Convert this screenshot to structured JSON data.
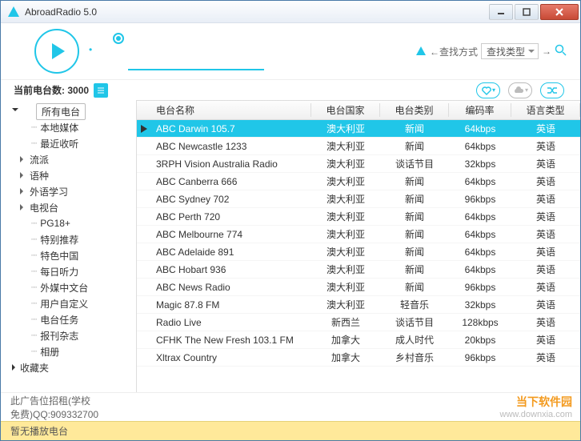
{
  "window": {
    "title": "AbroadRadio 5.0"
  },
  "count": {
    "label": "当前电台数:",
    "value": "3000"
  },
  "search": {
    "mode_prefix": "←查找方式",
    "type_placeholder": "查找类型",
    "arrow": "→"
  },
  "sidebar": {
    "root1": "所有电台",
    "children": [
      "本地媒体",
      "最近收听",
      "流派",
      "语种",
      "外语学习",
      "电视台",
      "PG18+",
      "特别推荐",
      "特色中国",
      "每日听力",
      "外媒中文台",
      "用户自定义",
      "电台任务",
      "报刊杂志",
      "相册"
    ],
    "root2": "收藏夹"
  },
  "columns": [
    "",
    "电台名称",
    "电台国家",
    "电台类别",
    "编码率",
    "语言类型"
  ],
  "rows": [
    {
      "name": "ABC Darwin 105.7",
      "country": "澳大利亚",
      "category": "新闻",
      "rate": "64kbps",
      "lang": "英语",
      "sel": true
    },
    {
      "name": "ABC Newcastle 1233",
      "country": "澳大利亚",
      "category": "新闻",
      "rate": "64kbps",
      "lang": "英语"
    },
    {
      "name": "3RPH Vision Australia Radio",
      "country": "澳大利亚",
      "category": "谈话节目",
      "rate": "32kbps",
      "lang": "英语"
    },
    {
      "name": "ABC Canberra 666",
      "country": "澳大利亚",
      "category": "新闻",
      "rate": "64kbps",
      "lang": "英语"
    },
    {
      "name": "ABC Sydney 702",
      "country": "澳大利亚",
      "category": "新闻",
      "rate": "96kbps",
      "lang": "英语"
    },
    {
      "name": "ABC Perth 720",
      "country": "澳大利亚",
      "category": "新闻",
      "rate": "64kbps",
      "lang": "英语"
    },
    {
      "name": "ABC Melbourne 774",
      "country": "澳大利亚",
      "category": "新闻",
      "rate": "64kbps",
      "lang": "英语"
    },
    {
      "name": "ABC Adelaide 891",
      "country": "澳大利亚",
      "category": "新闻",
      "rate": "64kbps",
      "lang": "英语"
    },
    {
      "name": "ABC Hobart 936",
      "country": "澳大利亚",
      "category": "新闻",
      "rate": "64kbps",
      "lang": "英语"
    },
    {
      "name": "ABC News Radio",
      "country": "澳大利亚",
      "category": "新闻",
      "rate": "96kbps",
      "lang": "英语"
    },
    {
      "name": "Magic 87.8 FM",
      "country": "澳大利亚",
      "category": "轻音乐",
      "rate": "32kbps",
      "lang": "英语"
    },
    {
      "name": "Radio Live",
      "country": "新西兰",
      "category": "谈话节目",
      "rate": "128kbps",
      "lang": "英语"
    },
    {
      "name": "CFHK The New Fresh 103.1 FM",
      "country": "加拿大",
      "category": "成人时代",
      "rate": "20kbps",
      "lang": "英语"
    },
    {
      "name": "Xltrax Country",
      "country": "加拿大",
      "category": "乡村音乐",
      "rate": "96kbps",
      "lang": "英语"
    }
  ],
  "ad": {
    "line1": "此广告位招租(学校",
    "line2": "免费)QQ:909332700"
  },
  "watermark": {
    "brand": "当下软件园",
    "url": "www.downxia.com"
  },
  "status": {
    "text": "暂无播放电台"
  }
}
